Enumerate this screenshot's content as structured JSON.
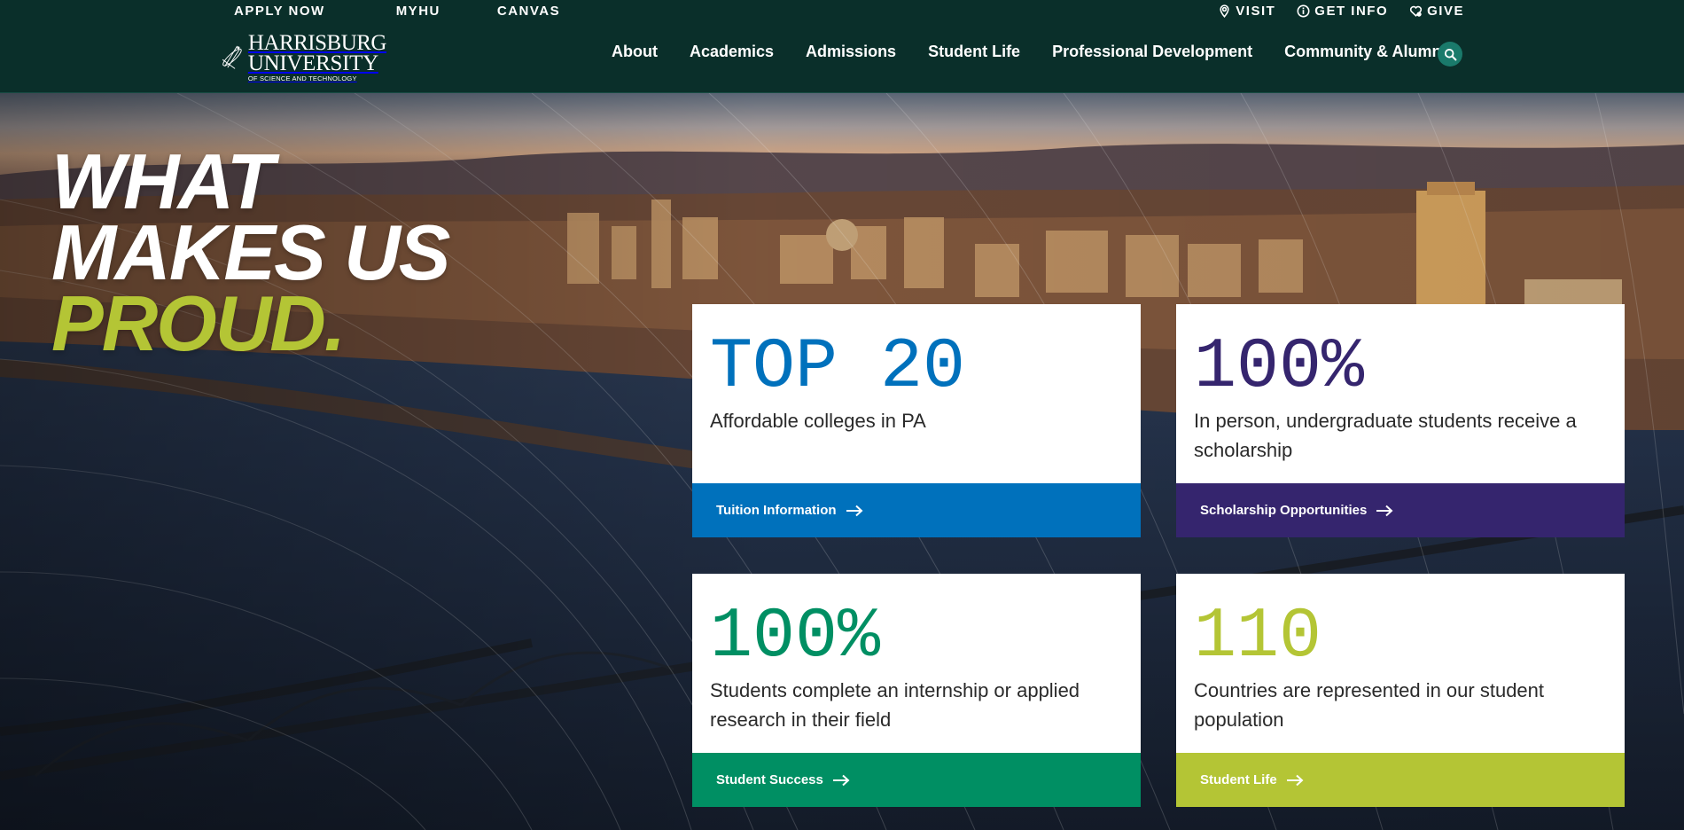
{
  "header": {
    "utility_left": [
      "APPLY NOW",
      "MYHU",
      "CANVAS"
    ],
    "utility_right": [
      {
        "icon": "map-pin-icon",
        "label": "VISIT"
      },
      {
        "icon": "info-icon",
        "label": "GET INFO"
      },
      {
        "icon": "heart-hand-icon",
        "label": "GIVE"
      }
    ],
    "logo": {
      "line1": "HARRISBURG",
      "line2": "UNIVERSITY",
      "line3": "OF SCIENCE AND TECHNOLOGY"
    },
    "nav": [
      "About",
      "Academics",
      "Admissions",
      "Student Life",
      "Professional Development",
      "Community & Alumni"
    ],
    "search_icon": "search-icon"
  },
  "hero": {
    "headline": {
      "line1": "WHAT",
      "line2": "MAKES US",
      "line3": "PROUD."
    },
    "cards": [
      {
        "stat": "TOP 20",
        "description": "Affordable colleges in PA",
        "link": "Tuition Information",
        "stat_color": "#0071bc",
        "bar_color": "#0071bc"
      },
      {
        "stat": "100%",
        "description": "In person, undergraduate students receive a scholarship",
        "link": "Scholarship Opportunities",
        "stat_color": "#35256e",
        "bar_color": "#35256e"
      },
      {
        "stat": "100%",
        "description": "Students complete an internship or applied research in their field",
        "link": "Student Success",
        "stat_color": "#008f63",
        "bar_color": "#008f63"
      },
      {
        "stat": "110",
        "description": "Countries are represented in our student population",
        "link": "Student Life",
        "stat_color": "#b4c535",
        "bar_color": "#b4c535"
      }
    ]
  },
  "colors": {
    "header_bg": "#0a2f2a",
    "accent_green": "#b4c535",
    "search_button": "#1a7a6b"
  }
}
